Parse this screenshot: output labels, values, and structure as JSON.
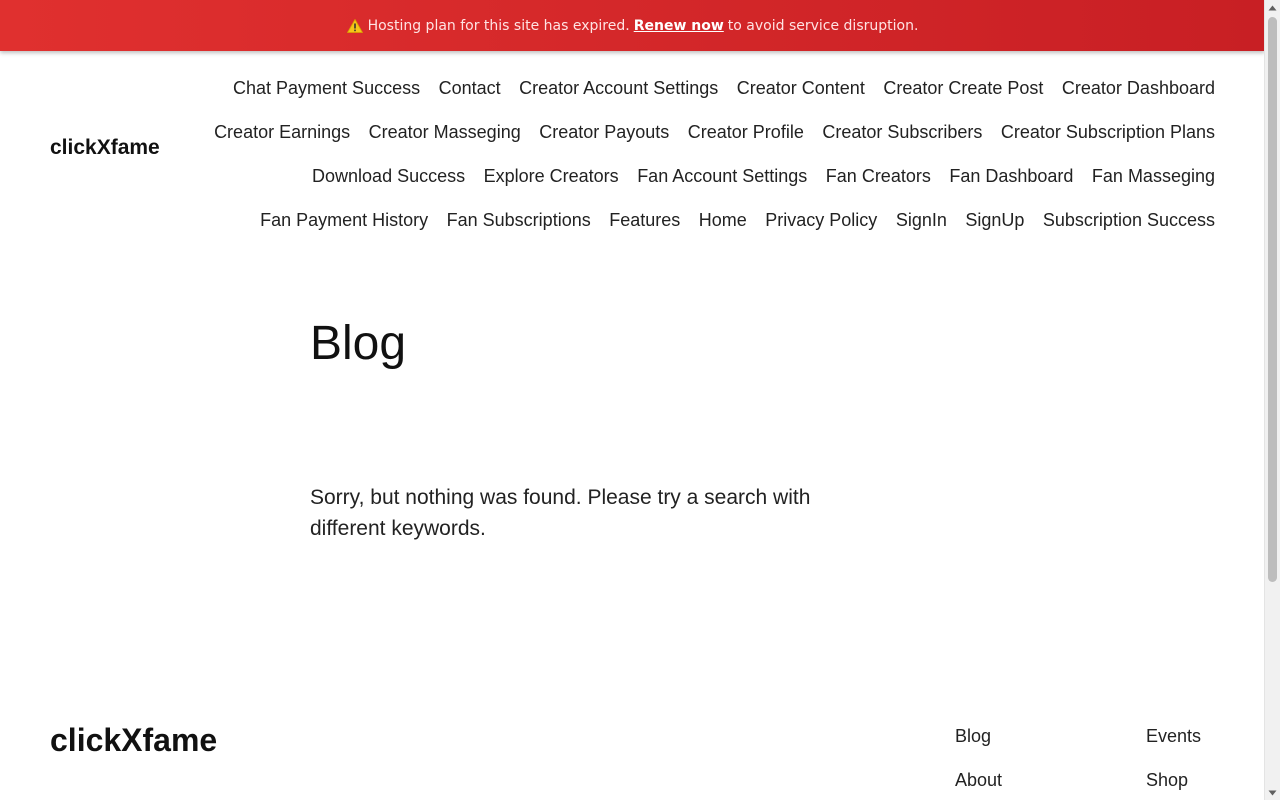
{
  "banner": {
    "message_before": "Hosting plan for this site has expired.",
    "link_label": "Renew now",
    "message_after": "to avoid service disruption.",
    "icon": "warning-icon"
  },
  "header": {
    "site_title": "clickXfame",
    "nav_rows": [
      [
        "Chat Payment Success",
        "Contact",
        "Creator Account Settings",
        "Creator Content",
        "Creator Create Post",
        "Creator Dashboard"
      ],
      [
        "Creator Earnings",
        "Creator Masseging",
        "Creator Payouts",
        "Creator Profile",
        "Creator Subscribers",
        "Creator Subscription Plans"
      ],
      [
        "Download Success",
        "Explore Creators",
        "Fan Account Settings",
        "Fan Creators",
        "Fan Dashboard",
        "Fan Masseging"
      ],
      [
        "Fan Payment History",
        "Fan Subscriptions",
        "Features",
        "Home",
        "Privacy Policy",
        "SignIn",
        "SignUp",
        "Subscription Success"
      ]
    ]
  },
  "main": {
    "heading": "Blog",
    "empty_message": "Sorry, but nothing was found. Please try a search with different keywords."
  },
  "footer": {
    "site_title": "clickXfame",
    "links": {
      "blog": "Blog",
      "events": "Events",
      "about": "About",
      "shop": "Shop"
    }
  },
  "colors": {
    "banner_bg": "#d62828",
    "text": "#111111"
  }
}
